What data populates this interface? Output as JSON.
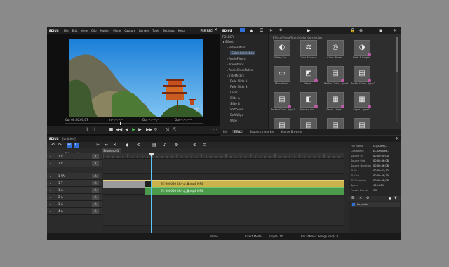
{
  "app": {
    "name": "EDIUS",
    "menu": [
      "File",
      "Edit",
      "View",
      "Clip",
      "Marker",
      "Mode",
      "Capture",
      "Render",
      "Tools",
      "Settings",
      "Help"
    ],
    "mode_badge": "PLR REC",
    "timeline_title": "EDIUS",
    "timeline_title_suffix": "[untitled]"
  },
  "player": {
    "timecode_cur": "Cur 00:00:07;07",
    "timecode_in": "In --:--:--;--",
    "timecode_out": "Out --:--:--;--",
    "timecode_dur": "Dur --:--:--;--",
    "pagoda_sign": "寺"
  },
  "effects": {
    "header": "EDIUS",
    "path": "Effect\\VideoFilters\\Color Correction",
    "folder_label": "FOLDER",
    "tree": [
      "Effect",
      "VideoFilters",
      "Color Correction",
      "AudioFilters",
      "Transitions",
      "AudioCrossFades",
      "TitleMixers",
      "Fade Slide A",
      "Fade Slide B",
      "Laser",
      "Slide A",
      "Slide B",
      "Soft Slide",
      "Soft Wipe",
      "Wipe"
    ],
    "items": [
      "3-Way Col...",
      "Color Balance",
      "Color Wheel",
      "Dark & Bright",
      "Monotone",
      "Nega",
      "Poster Color - type1",
      "Poster Color - type2",
      "Poster Color - type3",
      "Primary Col...",
      "Sepia - type1",
      "Sepia - type2",
      "",
      "",
      "",
      ""
    ],
    "tabs": [
      "Bin",
      "Effect",
      "Sequence marker",
      "Source Browser"
    ]
  },
  "timeline": {
    "sequence_tab": "Sequence1",
    "tracks": [
      {
        "name": "1 V",
        "label": "A"
      },
      {
        "name": "2 V",
        "label": "A"
      },
      {
        "name": "1 VA",
        "label": "A"
      },
      {
        "name": "1 T",
        "label": "A"
      },
      {
        "name": "1 A",
        "label": "A"
      },
      {
        "name": "2 A",
        "label": "A"
      },
      {
        "name": "3 A",
        "label": "A"
      },
      {
        "name": "4 A",
        "label": "A"
      }
    ],
    "scale_label": "1 Second",
    "clip_video_label": "EC-000036 4K小北漫.mp4 MP4",
    "clip_audio_label": "EC-000036 4K小北漫.mp4 MP4"
  },
  "info": {
    "rows": [
      {
        "k": "File Name",
        "v": "C:\\EDIUS\\..."
      },
      {
        "k": "Clip Name",
        "v": "EC-000036..."
      },
      {
        "k": "Source In",
        "v": "00:00:00;00"
      },
      {
        "k": "Source Out",
        "v": "00:00:36;08"
      },
      {
        "k": "Source Duration",
        "v": "00:00:36;08"
      },
      {
        "k": "TL In",
        "v": "00:00:03;12"
      },
      {
        "k": "TL Out",
        "v": "00:00:39;20"
      },
      {
        "k": "TL Duration",
        "v": "00:00:36;08"
      },
      {
        "k": "Speed",
        "v": "100.00%"
      },
      {
        "k": "Freeze Frame",
        "v": "Off"
      }
    ],
    "layer_label": "Layouter"
  },
  "status": {
    "left": "Pause",
    "insert": "Insert Mode",
    "ripple": "Ripple Off",
    "disk": "Disk: 46% is being used(C:)"
  },
  "colors": {
    "accent": "#2f6fd6",
    "clip_video": "#c9b34a",
    "clip_audio": "#4c9a4c"
  }
}
